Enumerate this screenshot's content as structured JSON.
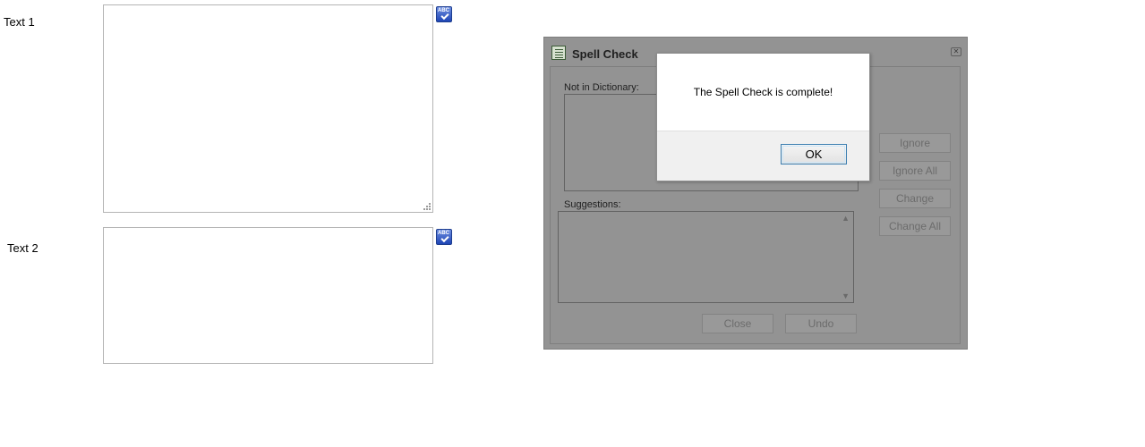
{
  "fields": [
    {
      "label": "Text 1",
      "value": "",
      "spellcheck_icon": "spellcheck-abc-icon"
    },
    {
      "label": "Text 2",
      "value": "",
      "spellcheck_icon": "spellcheck-abc-icon"
    }
  ],
  "spell_dialog": {
    "title": "Spell Check",
    "not_in_dictionary_label": "Not in Dictionary:",
    "not_in_dictionary_value": "",
    "suggestions_label": "Suggestions:",
    "buttons": {
      "ignore": "Ignore",
      "ignore_all": "Ignore All",
      "change": "Change",
      "change_all": "Change All",
      "close": "Close",
      "undo": "Undo"
    }
  },
  "alert": {
    "message": "The Spell Check is complete!",
    "ok_label": "OK"
  },
  "colors": {
    "dialog_overlay": "#939393",
    "alert_background": "#ffffff",
    "alert_footer": "#f0f0f0",
    "ok_border": "#3c7fb1",
    "spellcheck_icon_blue": "#1e45b5"
  }
}
